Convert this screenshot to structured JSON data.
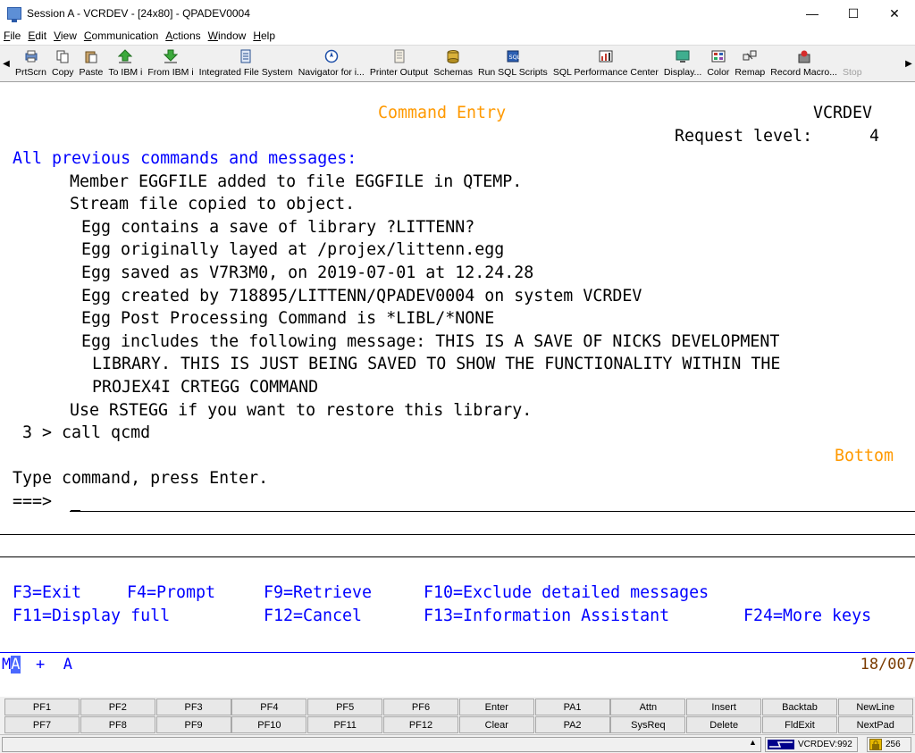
{
  "window": {
    "title": "Session A - VCRDEV - [24x80] - QPADEV0004",
    "controls": {
      "minimize": "—",
      "maximize": "☐",
      "close": "✕"
    }
  },
  "menu": [
    "File",
    "Edit",
    "View",
    "Communication",
    "Actions",
    "Window",
    "Help"
  ],
  "toolbar": [
    {
      "label": "PrtScrn",
      "icon": "print-screen-icon"
    },
    {
      "label": "Copy",
      "icon": "copy-icon"
    },
    {
      "label": "Paste",
      "icon": "paste-icon"
    },
    {
      "label": "To IBM i",
      "icon": "upload-arrow-icon"
    },
    {
      "label": "From IBM i",
      "icon": "download-arrow-icon"
    },
    {
      "label": "Integrated File System",
      "icon": "file-system-icon"
    },
    {
      "label": "Navigator for i...",
      "icon": "navigator-icon"
    },
    {
      "label": "Printer Output",
      "icon": "printer-output-icon"
    },
    {
      "label": "Schemas",
      "icon": "schemas-icon"
    },
    {
      "label": "Run SQL Scripts",
      "icon": "sql-scripts-icon"
    },
    {
      "label": "SQL Performance Center",
      "icon": "performance-center-icon"
    },
    {
      "label": "Display...",
      "icon": "display-icon"
    },
    {
      "label": "Color",
      "icon": "color-icon"
    },
    {
      "label": "Remap",
      "icon": "remap-icon"
    },
    {
      "label": "Record Macro...",
      "icon": "record-macro-icon"
    },
    {
      "label": "Stop",
      "icon": "stop-icon"
    }
  ],
  "screen": {
    "title": "Command Entry",
    "system": "VCRDEV",
    "request_level_label": "Request level:",
    "request_level": "4",
    "section_heading": "All previous commands and messages:",
    "messages": [
      "Member EGGFILE added to file EGGFILE in QTEMP.",
      "Stream file copied to object.",
      "Egg contains a save of library ?LITTENN?",
      "Egg originally layed at /projex/littenn.egg",
      "Egg saved as V7R3M0, on 2019-07-01 at 12.24.28",
      "Egg created by 718895/LITTENN/QPADEV0004 on system VCRDEV",
      "Egg Post Processing Command is *LIBL/*NONE",
      "Egg includes the following message: THIS IS A SAVE OF NICKS DEVELOPMENT",
      "LIBRARY. THIS IS JUST BEING SAVED TO SHOW THE FUNCTIONALITY WITHIN THE",
      "PROJEX4I CRTEGG COMMAND",
      "Use RSTEGG if you want to restore this library."
    ],
    "command_line": " 3 > call qcmd",
    "bottom_indicator": "Bottom",
    "prompt": "Type command, press Enter.",
    "input_arrow": "===>",
    "function_keys_row1": [
      "F3=Exit",
      "F4=Prompt",
      "F9=Retrieve",
      "F10=Exclude detailed messages"
    ],
    "function_keys_row2": [
      "F11=Display full",
      "F12=Cancel",
      "F13=Information Assistant",
      "F24=More keys"
    ]
  },
  "oia": {
    "mode_prefix": "M",
    "mode_highlight": "A",
    "flags": "+  A",
    "cursor_position": "18/007"
  },
  "keypad_row1": [
    "PF1",
    "PF2",
    "PF3",
    "PF4",
    "PF5",
    "PF6",
    "Enter",
    "PA1",
    "Attn",
    "Insert",
    "Backtab",
    "NewLine"
  ],
  "keypad_row2": [
    "PF7",
    "PF8",
    "PF9",
    "PF10",
    "PF11",
    "PF12",
    "Clear",
    "PA2",
    "SysReq",
    "Delete",
    "FldExit",
    "NextPad"
  ],
  "statusbar": {
    "up_arrow": "▲",
    "connection": "VCRDEV:992",
    "encryption": "256"
  },
  "colors": {
    "field_blue": "#0000ff",
    "title_orange": "#ff9900",
    "position_brown": "#7a3b00"
  }
}
